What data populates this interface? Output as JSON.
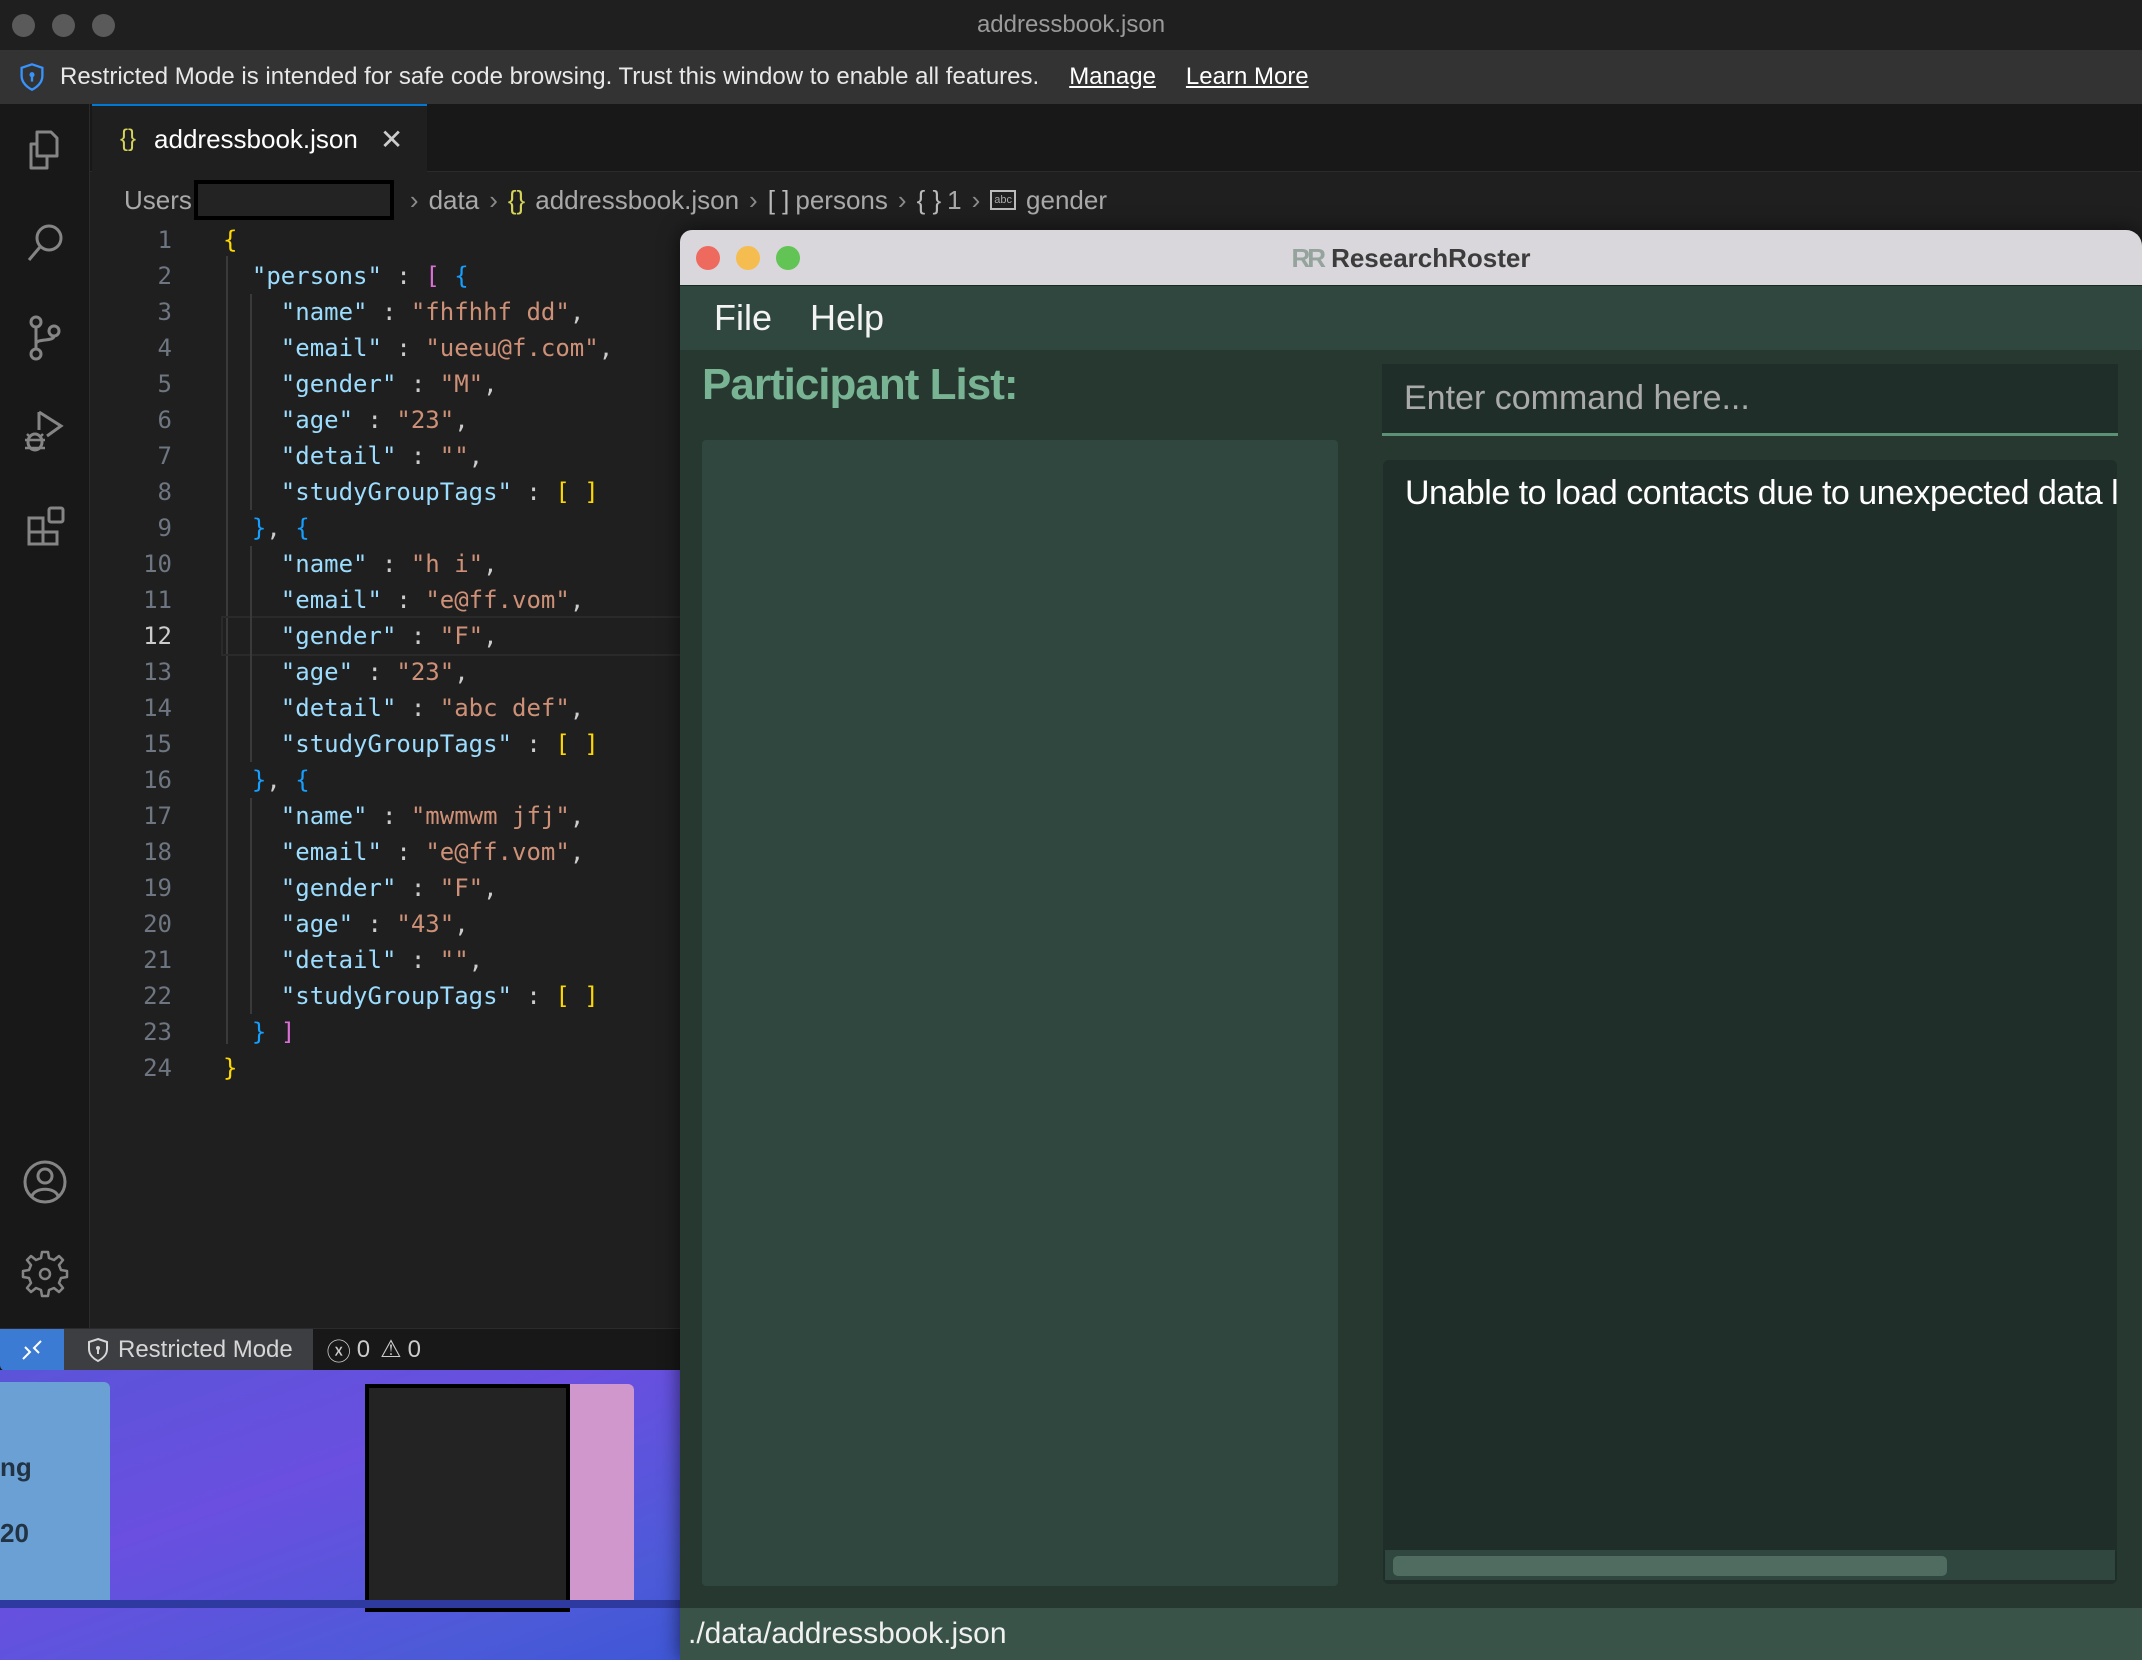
{
  "vscode": {
    "window_title": "addressbook.json",
    "banner": {
      "message": "Restricted Mode is intended for safe code browsing. Trust this window to enable all features.",
      "manage_link": "Manage",
      "learn_more_link": "Learn More"
    },
    "activity_bar": {
      "top": [
        "explorer-icon",
        "search-icon",
        "source-control-icon",
        "run-debug-icon",
        "extensions-icon"
      ],
      "bottom": [
        "account-icon",
        "settings-gear-icon"
      ]
    },
    "tab": {
      "label": "addressbook.json",
      "icon": "json-braces-icon"
    },
    "breadcrumb": {
      "root": "Users",
      "items": [
        "data",
        "addressbook.json",
        "persons",
        "1",
        "gender"
      ]
    },
    "active_line": 12,
    "code_lines": [
      [
        [
          "b1",
          "{"
        ]
      ],
      [
        [
          "p",
          "  "
        ],
        [
          "k",
          "\"persons\""
        ],
        [
          "p",
          " : "
        ],
        [
          "b2",
          "["
        ],
        [
          "p",
          " "
        ],
        [
          "b3",
          "{"
        ]
      ],
      [
        [
          "p",
          "    "
        ],
        [
          "k",
          "\"name\""
        ],
        [
          "p",
          " : "
        ],
        [
          "s",
          "\"fhfhhf dd\""
        ],
        [
          "p",
          ","
        ]
      ],
      [
        [
          "p",
          "    "
        ],
        [
          "k",
          "\"email\""
        ],
        [
          "p",
          " : "
        ],
        [
          "s",
          "\"ueeu@f.com\""
        ],
        [
          "p",
          ","
        ]
      ],
      [
        [
          "p",
          "    "
        ],
        [
          "k",
          "\"gender\""
        ],
        [
          "p",
          " : "
        ],
        [
          "s",
          "\"M\""
        ],
        [
          "p",
          ","
        ]
      ],
      [
        [
          "p",
          "    "
        ],
        [
          "k",
          "\"age\""
        ],
        [
          "p",
          " : "
        ],
        [
          "s",
          "\"23\""
        ],
        [
          "p",
          ","
        ]
      ],
      [
        [
          "p",
          "    "
        ],
        [
          "k",
          "\"detail\""
        ],
        [
          "p",
          " : "
        ],
        [
          "s",
          "\"\""
        ],
        [
          "p",
          ","
        ]
      ],
      [
        [
          "p",
          "    "
        ],
        [
          "k",
          "\"studyGroupTags\""
        ],
        [
          "p",
          " : "
        ],
        [
          "b1",
          "[ ]"
        ]
      ],
      [
        [
          "p",
          "  "
        ],
        [
          "b3",
          "}"
        ],
        [
          "p",
          ", "
        ],
        [
          "b3",
          "{"
        ]
      ],
      [
        [
          "p",
          "    "
        ],
        [
          "k",
          "\"name\""
        ],
        [
          "p",
          " : "
        ],
        [
          "s",
          "\"h i\""
        ],
        [
          "p",
          ","
        ]
      ],
      [
        [
          "p",
          "    "
        ],
        [
          "k",
          "\"email\""
        ],
        [
          "p",
          " : "
        ],
        [
          "s",
          "\"e@ff.vom\""
        ],
        [
          "p",
          ","
        ]
      ],
      [
        [
          "p",
          "    "
        ],
        [
          "k",
          "\"gender\""
        ],
        [
          "p",
          " : "
        ],
        [
          "s",
          "\"F\""
        ],
        [
          "p",
          ","
        ]
      ],
      [
        [
          "p",
          "    "
        ],
        [
          "k",
          "\"age\""
        ],
        [
          "p",
          " : "
        ],
        [
          "s",
          "\"23\""
        ],
        [
          "p",
          ","
        ]
      ],
      [
        [
          "p",
          "    "
        ],
        [
          "k",
          "\"detail\""
        ],
        [
          "p",
          " : "
        ],
        [
          "s",
          "\"abc def\""
        ],
        [
          "p",
          ","
        ]
      ],
      [
        [
          "p",
          "    "
        ],
        [
          "k",
          "\"studyGroupTags\""
        ],
        [
          "p",
          " : "
        ],
        [
          "b1",
          "[ ]"
        ]
      ],
      [
        [
          "p",
          "  "
        ],
        [
          "b3",
          "}"
        ],
        [
          "p",
          ", "
        ],
        [
          "b3",
          "{"
        ]
      ],
      [
        [
          "p",
          "    "
        ],
        [
          "k",
          "\"name\""
        ],
        [
          "p",
          " : "
        ],
        [
          "s",
          "\"mwmwm jfj\""
        ],
        [
          "p",
          ","
        ]
      ],
      [
        [
          "p",
          "    "
        ],
        [
          "k",
          "\"email\""
        ],
        [
          "p",
          " : "
        ],
        [
          "s",
          "\"e@ff.vom\""
        ],
        [
          "p",
          ","
        ]
      ],
      [
        [
          "p",
          "    "
        ],
        [
          "k",
          "\"gender\""
        ],
        [
          "p",
          " : "
        ],
        [
          "s",
          "\"F\""
        ],
        [
          "p",
          ","
        ]
      ],
      [
        [
          "p",
          "    "
        ],
        [
          "k",
          "\"age\""
        ],
        [
          "p",
          " : "
        ],
        [
          "s",
          "\"43\""
        ],
        [
          "p",
          ","
        ]
      ],
      [
        [
          "p",
          "    "
        ],
        [
          "k",
          "\"detail\""
        ],
        [
          "p",
          " : "
        ],
        [
          "s",
          "\"\""
        ],
        [
          "p",
          ","
        ]
      ],
      [
        [
          "p",
          "    "
        ],
        [
          "k",
          "\"studyGroupTags\""
        ],
        [
          "p",
          " : "
        ],
        [
          "b1",
          "[ ]"
        ]
      ],
      [
        [
          "p",
          "  "
        ],
        [
          "b3",
          "}"
        ],
        [
          "p",
          " "
        ],
        [
          "b2",
          "]"
        ]
      ],
      [
        [
          "b1",
          "}"
        ]
      ]
    ],
    "status_bar": {
      "remote_icon": "remote-icon",
      "restricted_mode": "Restricted Mode",
      "errors": "0",
      "warnings": "0"
    }
  },
  "wallpaper": {
    "card_text_1": "ng",
    "card_text_2": "20"
  },
  "app": {
    "title": "ResearchRoster",
    "logo_text": "RR",
    "menu": [
      "File",
      "Help"
    ],
    "participant_heading": "Participant List:",
    "command_placeholder": "Enter command here...",
    "command_value": "",
    "result_message": "Unable to load contacts due to unexpected data loss",
    "result_scroll_fraction": 0.77,
    "status_path": "./data/addressbook.json",
    "colors": {
      "accent_green": "#78b394",
      "close": "#ee6a5f",
      "minimize": "#f5bd4f",
      "maximize": "#61c454"
    }
  }
}
